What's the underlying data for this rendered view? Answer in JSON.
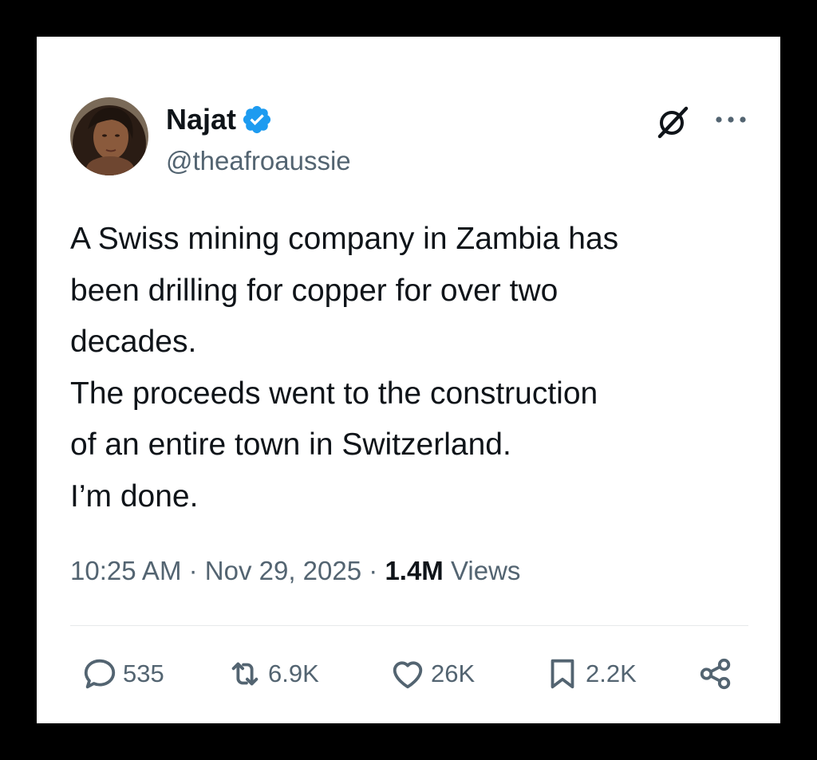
{
  "author": {
    "display_name": "Najat",
    "handle": "@theafroaussie",
    "verified": true
  },
  "tweet": {
    "lines": [
      "A Swiss mining company in Zambia has",
      "been drilling for copper for over two",
      "decades.",
      "The proceeds went to the construction",
      "of an entire town in Switzerland.",
      "I’m done."
    ]
  },
  "meta": {
    "time": "10:25 AM",
    "separator": "·",
    "date": "Nov 29, 2025",
    "views_count": "1.4M",
    "views_label": "Views"
  },
  "actions": {
    "replies": "535",
    "reposts": "6.9K",
    "likes": "26K",
    "bookmarks": "2.2K"
  },
  "icons": {
    "verified": "verified-badge-icon",
    "grok": "grok-icon",
    "more": "more-icon",
    "reply": "reply-icon",
    "repost": "repost-icon",
    "like": "heart-icon",
    "bookmark": "bookmark-icon",
    "share": "share-icon"
  },
  "colors": {
    "verified_blue": "#1d9bf0",
    "text_primary": "#0f1419",
    "text_secondary": "#536471"
  }
}
